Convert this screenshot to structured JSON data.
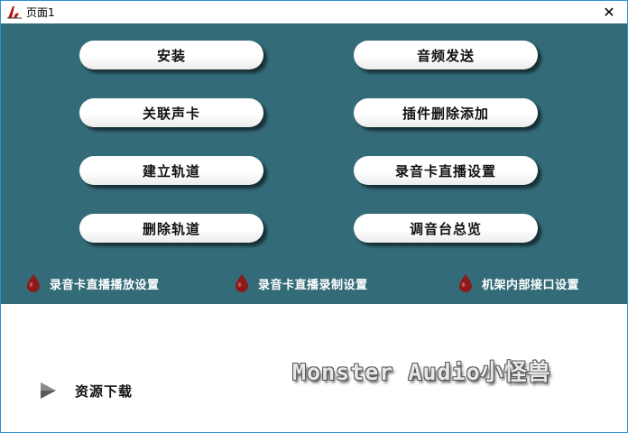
{
  "window": {
    "title": "页面1",
    "close_glyph": "✕",
    "icon": "app-logo-icon"
  },
  "buttons": {
    "install": "安装",
    "audio_send": "音频发送",
    "link_soundcard": "关联声卡",
    "plugin_remove_add": "插件删除添加",
    "create_track": "建立轨道",
    "recording_card_live": "录音卡直播设置",
    "delete_track": "删除轨道",
    "mixer_overview": "调音台总览"
  },
  "links": {
    "playback_settings": "录音卡直播播放设置",
    "record_settings": "录音卡直播录制设置",
    "rack_port_settings": "机架内部接口设置"
  },
  "footer": {
    "download": "资源下载",
    "brand": "Monster Audio小怪兽"
  },
  "colors": {
    "panel": "#336b78",
    "pill": "#ffffff",
    "drop_icon": "#8b1a1a",
    "window_border": "#2e8fd6"
  }
}
